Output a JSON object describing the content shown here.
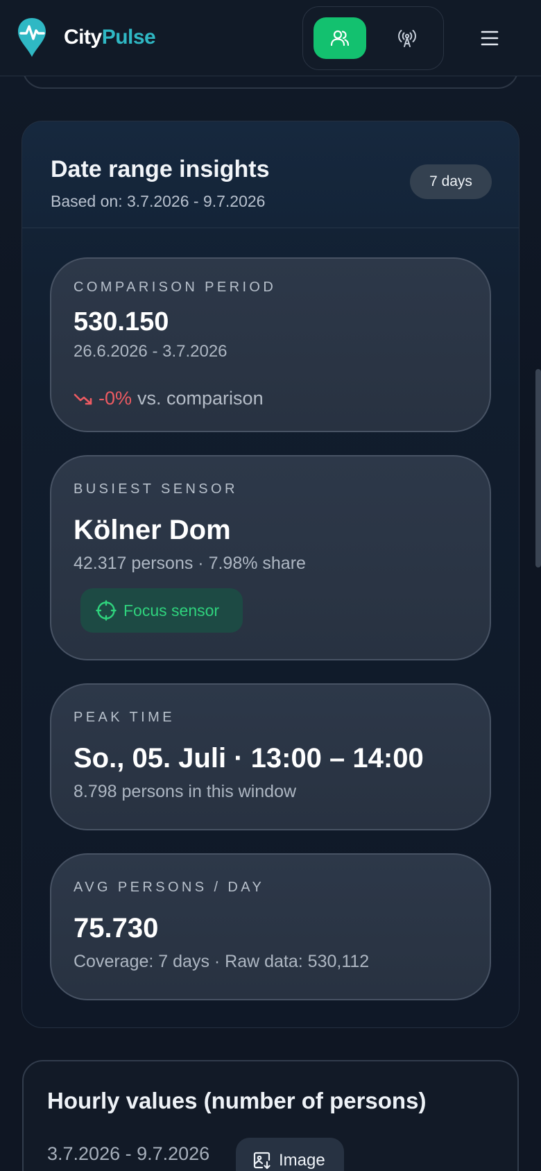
{
  "header": {
    "brand_part1": "City",
    "brand_part2": "Pulse",
    "mode_persons_icon": "users-icon",
    "mode_sensors_icon": "antenna-icon",
    "menu_icon": "hamburger-menu-icon"
  },
  "insights": {
    "title": "Date range insights",
    "based_on": "Based on: 3.7.2026 - 9.7.2026",
    "days_badge": "7 days",
    "comparison": {
      "label": "COMPARISON PERIOD",
      "value": "530.150",
      "range": "26.6.2026 - 3.7.2026",
      "trend_value": "-0%",
      "trend_text": "vs. comparison"
    },
    "busiest": {
      "label": "BUSIEST SENSOR",
      "name": "Kölner Dom",
      "detail": "42.317 persons · 7.98% share",
      "focus_label": "Focus sensor"
    },
    "peak": {
      "label": "PEAK TIME",
      "value": "So., 05. Juli · 13:00 – 14:00",
      "detail": "8.798 persons in this window"
    },
    "avg": {
      "label": "AVG PERSONS / DAY",
      "value": "75.730",
      "detail": "Coverage: 7 days · Raw data: 530,112"
    }
  },
  "hourly": {
    "title": "Hourly values (number of persons)",
    "range": "3.7.2026 - 9.7.2026",
    "image_label": "Image"
  },
  "colors": {
    "accent_green": "#13c16f",
    "brand_teal": "#2fb8c4",
    "negative_red": "#ee5b62"
  }
}
